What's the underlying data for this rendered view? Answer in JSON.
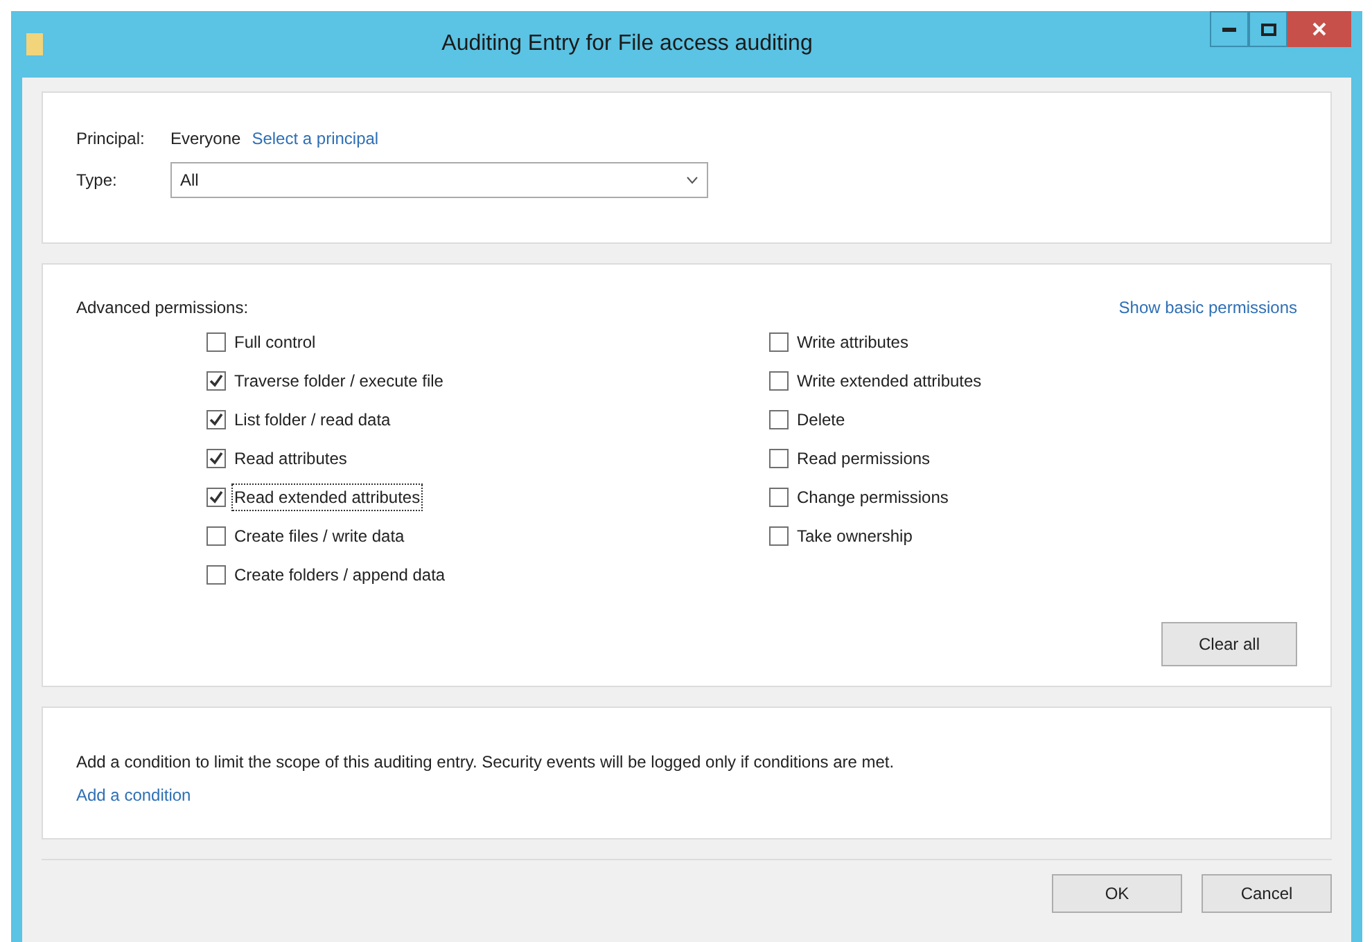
{
  "window": {
    "title": "Auditing Entry for File access auditing"
  },
  "principal": {
    "label": "Principal:",
    "value": "Everyone",
    "link": "Select a principal"
  },
  "type": {
    "label": "Type:",
    "value": "All"
  },
  "permissions": {
    "heading": "Advanced permissions:",
    "toggle_link": "Show basic permissions",
    "left": [
      {
        "label": "Full control",
        "checked": false,
        "focused": false
      },
      {
        "label": "Traverse folder / execute file",
        "checked": true,
        "focused": false
      },
      {
        "label": "List folder / read data",
        "checked": true,
        "focused": false
      },
      {
        "label": "Read attributes",
        "checked": true,
        "focused": false
      },
      {
        "label": "Read extended attributes",
        "checked": true,
        "focused": true
      },
      {
        "label": "Create files / write data",
        "checked": false,
        "focused": false
      },
      {
        "label": "Create folders / append data",
        "checked": false,
        "focused": false
      }
    ],
    "right": [
      {
        "label": "Write attributes",
        "checked": false,
        "focused": false
      },
      {
        "label": "Write extended attributes",
        "checked": false,
        "focused": false
      },
      {
        "label": "Delete",
        "checked": false,
        "focused": false
      },
      {
        "label": "Read permissions",
        "checked": false,
        "focused": false
      },
      {
        "label": "Change permissions",
        "checked": false,
        "focused": false
      },
      {
        "label": "Take ownership",
        "checked": false,
        "focused": false
      }
    ],
    "clear_button": "Clear all"
  },
  "condition": {
    "text": "Add a condition to limit the scope of this auditing entry. Security events will be logged only if conditions are met.",
    "link": "Add a condition"
  },
  "buttons": [
    "OK",
    "Cancel"
  ]
}
